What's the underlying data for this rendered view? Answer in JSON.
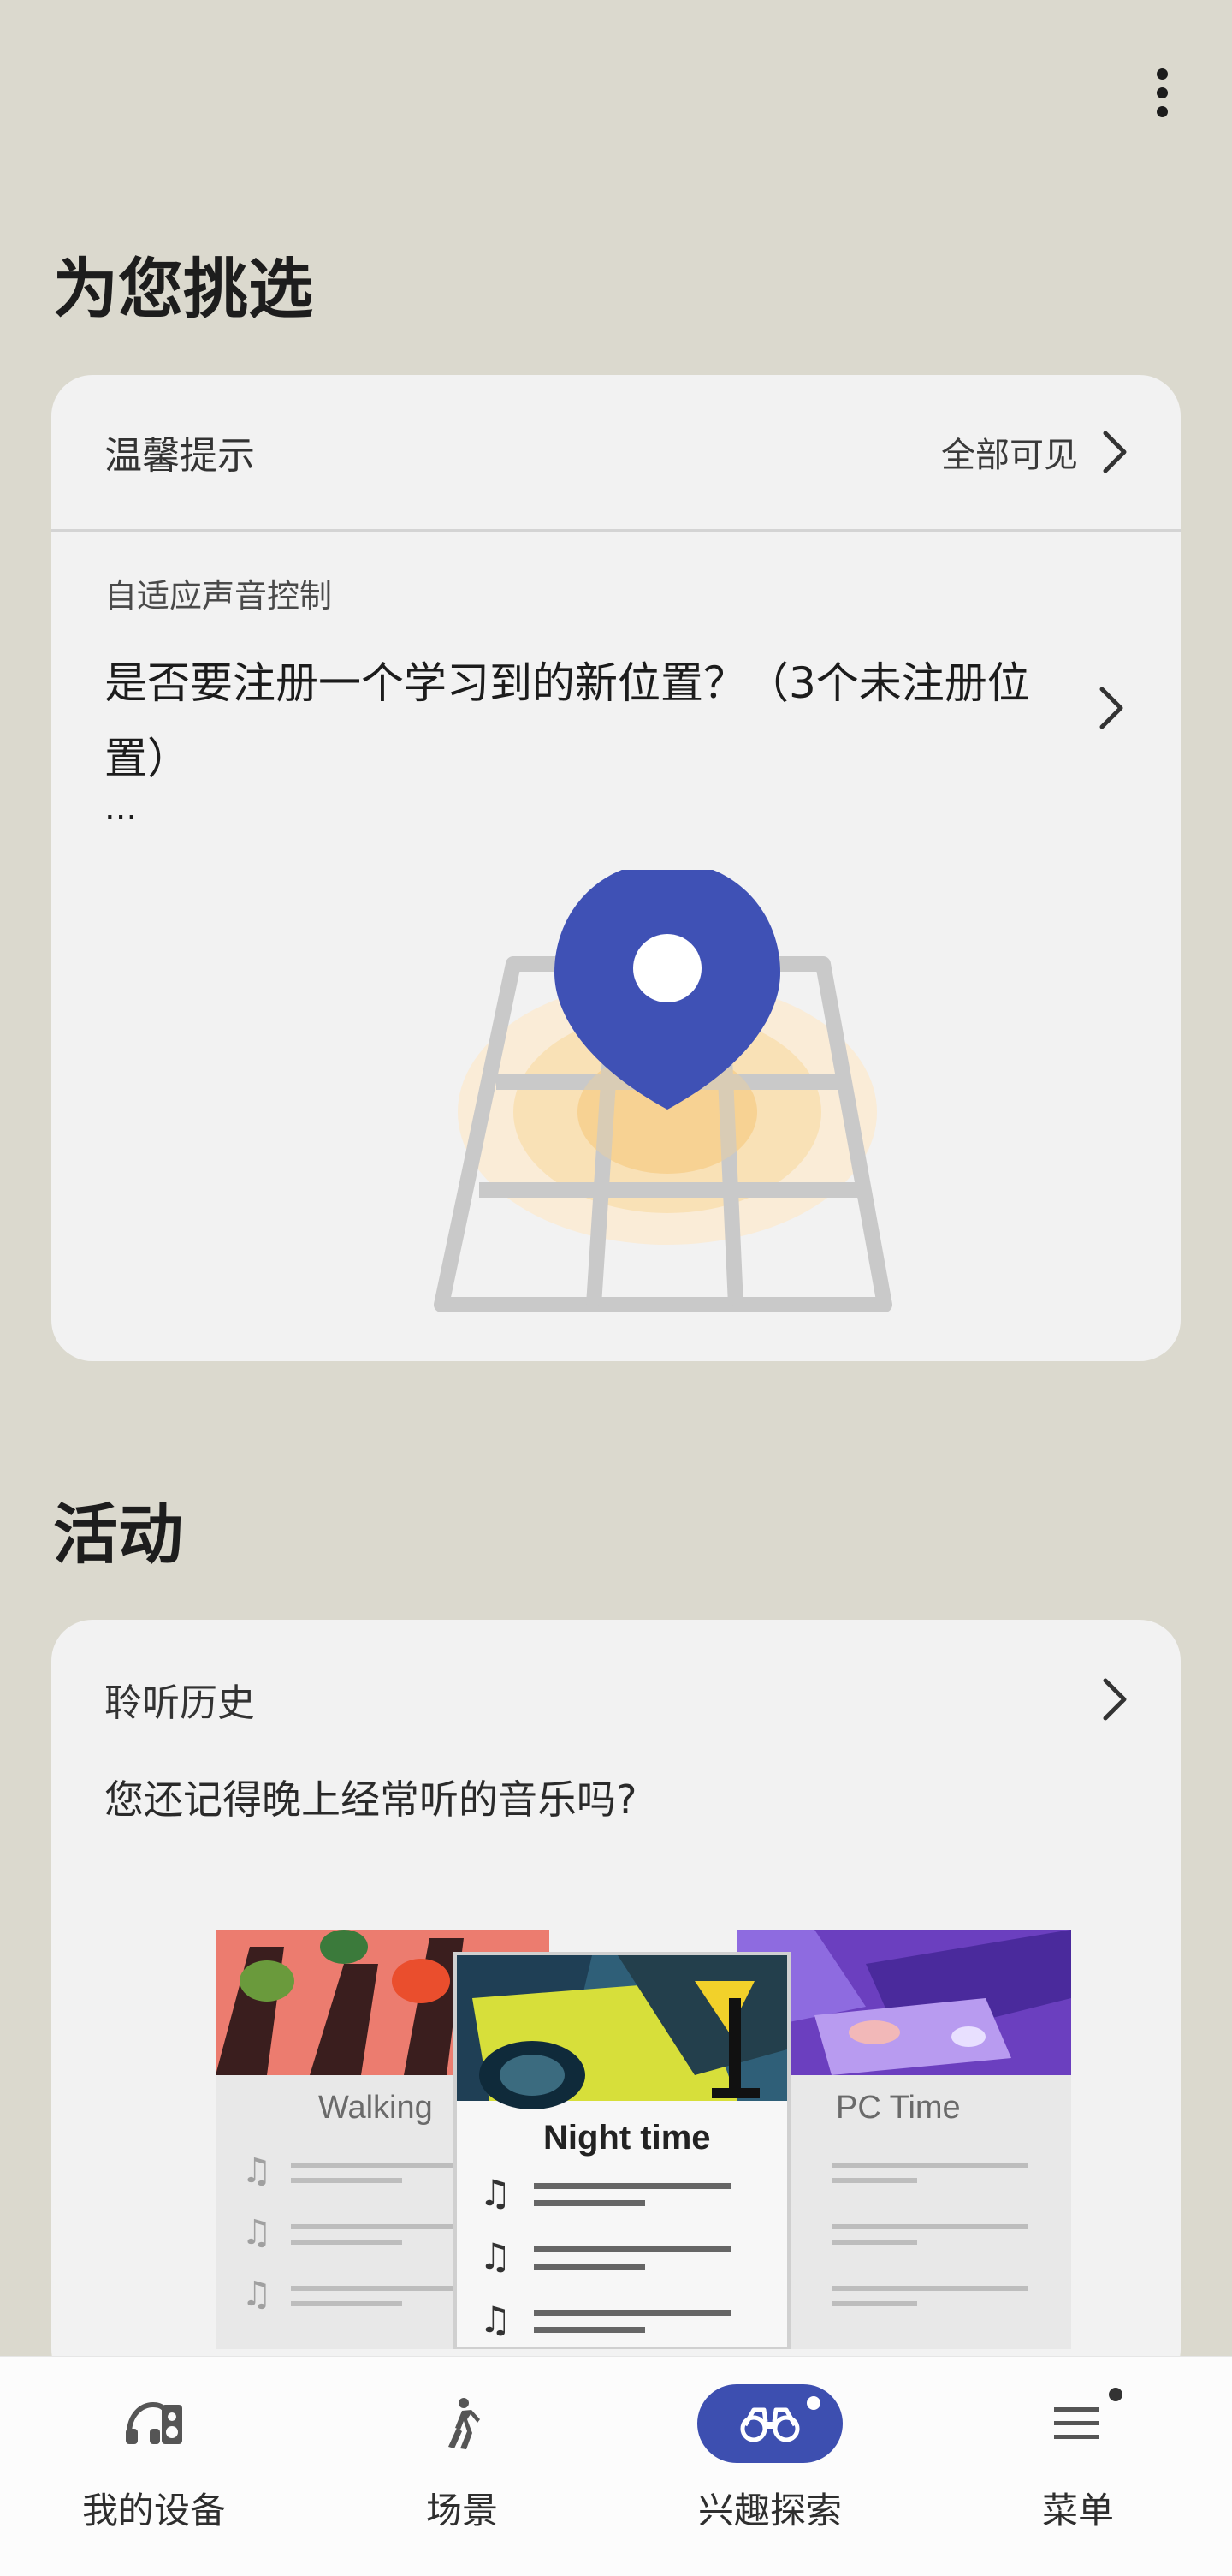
{
  "header": {
    "more_icon": "more-vert-icon"
  },
  "picks": {
    "title": "为您挑选",
    "card": {
      "header_label": "温馨提示",
      "see_all": "全部可见",
      "subtitle": "自适应声音控制",
      "text": "是否要注册一个学习到的新位置？（3个未注册位置）",
      "ellipsis": "...",
      "illustration": "map-pin-location-illustration",
      "pin_color": "#3f51b5"
    }
  },
  "activity": {
    "title": "活动",
    "card": {
      "header_label": "聆听历史",
      "subtitle": "您还记得晚上经常听的音乐吗?",
      "playlists": {
        "left": "Walking",
        "center": "Night time",
        "right": "PC Time"
      }
    }
  },
  "bottom_nav": {
    "items": [
      {
        "label": "我的设备",
        "icon": "headphones-device-icon",
        "active": false
      },
      {
        "label": "场景",
        "icon": "walking-person-icon",
        "active": false
      },
      {
        "label": "兴趣探索",
        "icon": "binoculars-icon",
        "active": true
      },
      {
        "label": "菜单",
        "icon": "menu-icon",
        "active": false
      }
    ],
    "accent": "#3d4fb0"
  }
}
